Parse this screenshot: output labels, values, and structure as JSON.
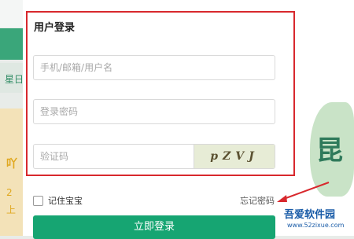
{
  "background": {
    "left_text": "星日",
    "ad_char": "吖",
    "ad_num1": "2",
    "ad_num2": "上"
  },
  "login": {
    "title": "用户登录",
    "username_placeholder": "手机/邮箱/用户名",
    "password_placeholder": "登录密码",
    "captcha_placeholder": "验证码",
    "captcha_text": "pZVJ",
    "remember_label": "记住宝宝",
    "forgot_label": "忘记密码",
    "submit_label": "立即登录"
  },
  "decor": {
    "glyph": "昆"
  },
  "watermark": {
    "name": "吾爱软件园",
    "url": "www.52zixue.com"
  },
  "colors": {
    "accent": "#16a572",
    "highlight": "#d8282d"
  }
}
